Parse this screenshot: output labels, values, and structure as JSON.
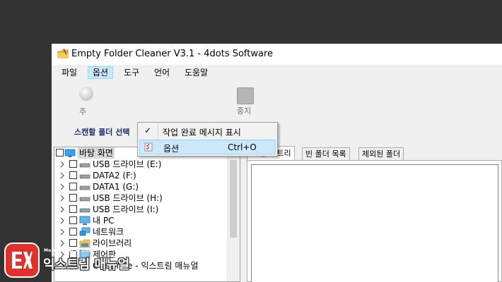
{
  "window": {
    "title": "Empty Folder Cleaner V3.1 - 4dots Software"
  },
  "menubar": {
    "items": [
      {
        "label": "파일"
      },
      {
        "label": "옵션"
      },
      {
        "label": "도구"
      },
      {
        "label": "언어"
      },
      {
        "label": "도움말"
      }
    ]
  },
  "options_menu": {
    "items": [
      {
        "label": "작업 완료 메시지 표시",
        "checked": true,
        "shortcut": ""
      },
      {
        "label": "옵션",
        "checked": false,
        "shortcut": "Ctrl+O"
      }
    ]
  },
  "toolbar": {
    "partial_label_1": "주",
    "stop_label": "중지"
  },
  "scan": {
    "label": "스캔할 폴더 선택"
  },
  "tree": {
    "items": [
      {
        "label": "바탕 화면",
        "icon": "desktop-icon",
        "level": 0,
        "expander": false,
        "selected": true
      },
      {
        "label": "USB 드라이브 (E:)",
        "icon": "drive-icon",
        "level": 1,
        "expander": true
      },
      {
        "label": "DATA2 (F:)",
        "icon": "drive-icon",
        "level": 1,
        "expander": true
      },
      {
        "label": "DATA1 (G:)",
        "icon": "drive-icon",
        "level": 1,
        "expander": true
      },
      {
        "label": "USB 드라이브 (H:)",
        "icon": "drive-icon",
        "level": 1,
        "expander": true
      },
      {
        "label": "USB 드라이브 (I:)",
        "icon": "drive-icon",
        "level": 1,
        "expander": true
      },
      {
        "label": "내 PC",
        "icon": "computer-icon",
        "level": 1,
        "expander": true
      },
      {
        "label": "네트워크",
        "icon": "network-icon",
        "level": 1,
        "expander": true
      },
      {
        "label": "라이브러리",
        "icon": "library-icon",
        "level": 1,
        "expander": true
      },
      {
        "label": "제어판",
        "icon": "control-panel-icon",
        "level": 1,
        "expander": true
      },
      {
        "label": "OneDrive - 익스트림 매뉴얼",
        "icon": "cloud-icon",
        "level": 1,
        "expander": true
      }
    ]
  },
  "tabs": [
    {
      "label": "빈 폴더 트리",
      "active": true
    },
    {
      "label": "빈 폴더 목록",
      "active": false
    },
    {
      "label": "제외된 폴더",
      "active": false
    }
  ],
  "watermark": {
    "small": "More Better IT Life",
    "big": "익스트림 매뉴얼"
  },
  "colors": {
    "menu_highlight": "#cce8ff",
    "menu_highlight_border": "#99d1ff",
    "scan_label": "#1f2d6b",
    "watermark_badge": "#e0322b"
  }
}
